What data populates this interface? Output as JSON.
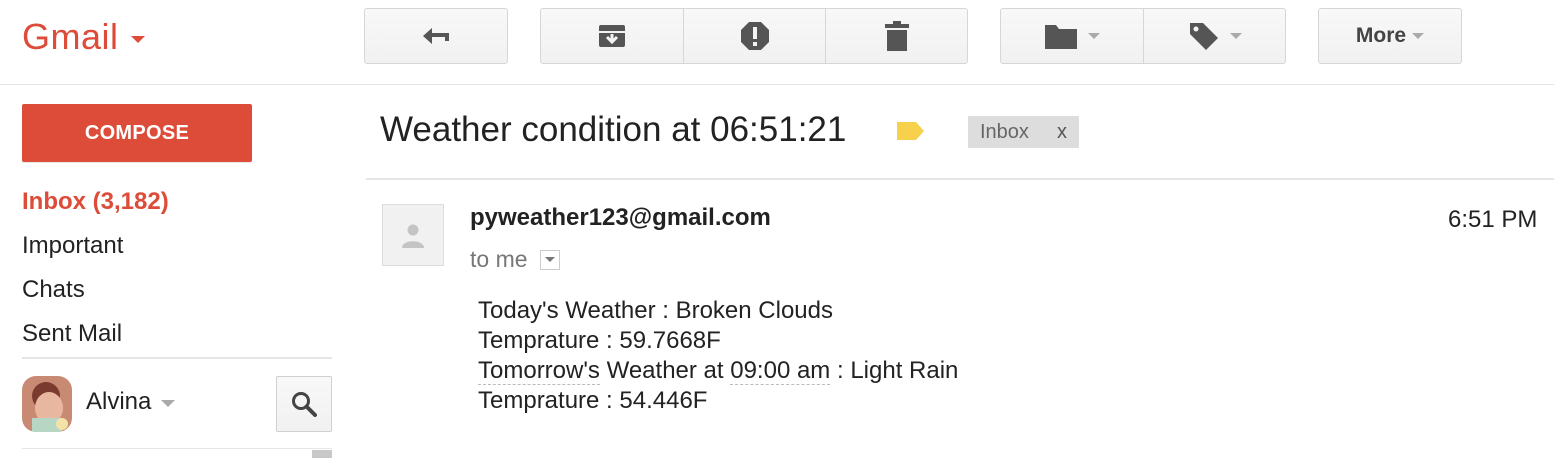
{
  "header": {
    "app_name": "Gmail",
    "toolbar": {
      "reply_icon": "reply-icon",
      "archive_icon": "archive-icon",
      "spam_icon": "report-spam-icon",
      "delete_icon": "trash-icon",
      "move_icon": "folder-icon",
      "labels_icon": "tag-icon",
      "more_label": "More"
    }
  },
  "sidebar": {
    "compose_label": "COMPOSE",
    "items": [
      {
        "label": "Inbox (3,182)",
        "active": true
      },
      {
        "label": "Important"
      },
      {
        "label": "Chats"
      },
      {
        "label": "Sent Mail"
      }
    ],
    "user": {
      "name": "Alvina"
    }
  },
  "message": {
    "subject": "Weather condition at 06:51:21",
    "label_chip": "Inbox",
    "label_chip_close": "x",
    "sender": "pyweather123@gmail.com",
    "recipient": "to me",
    "time": "6:51 PM",
    "body": {
      "line1": "Today's Weather : Broken Clouds",
      "line2": "Temprature : 59.7668F",
      "line3_a": "Tomorrow's",
      "line3_b": " Weather at ",
      "line3_c": "09:00 am",
      "line3_d": " : Light Rain",
      "line4": "Temprature : 54.446F"
    }
  },
  "colors": {
    "brand": "#dd4b39",
    "important_marker": "#f7d14c"
  }
}
